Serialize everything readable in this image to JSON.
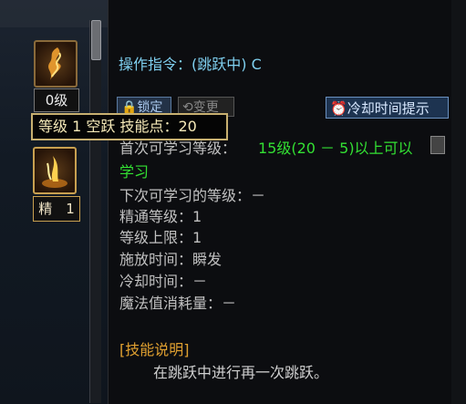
{
  "left_panel": {
    "slot1_level": "0级",
    "slot2_level": "精　1",
    "tooltip": "等级 1 空跃 技能点：20"
  },
  "detail": {
    "command": "操作指令：(跳跃中) C",
    "lock_button": "锁定",
    "change_button": "变更",
    "cooldown_button": "冷却时间提示",
    "next_learn_label": "首次可学习等级：",
    "next_learn_value": "15级(20 － 5)以上可以",
    "next_learn_value2": "学习",
    "rows": [
      "下次可学习的等级：－",
      "精通等级：1",
      "等级上限：1",
      "施放时间：瞬发",
      "冷却时间：－",
      "魔法值消耗量：－"
    ],
    "skill_desc_title": "[技能说明]",
    "skill_desc": "在跳跃中进行再一次跳跃。"
  },
  "colors": {
    "command": "#7fd0f0",
    "green": "#33e033",
    "section_title": "#e0a030",
    "tooltip_border": "#c8b070"
  },
  "icons": [
    "skill-flame-icon",
    "skill-jump-icon",
    "lock-icon",
    "clock-icon",
    "side-scroll-icon"
  ]
}
